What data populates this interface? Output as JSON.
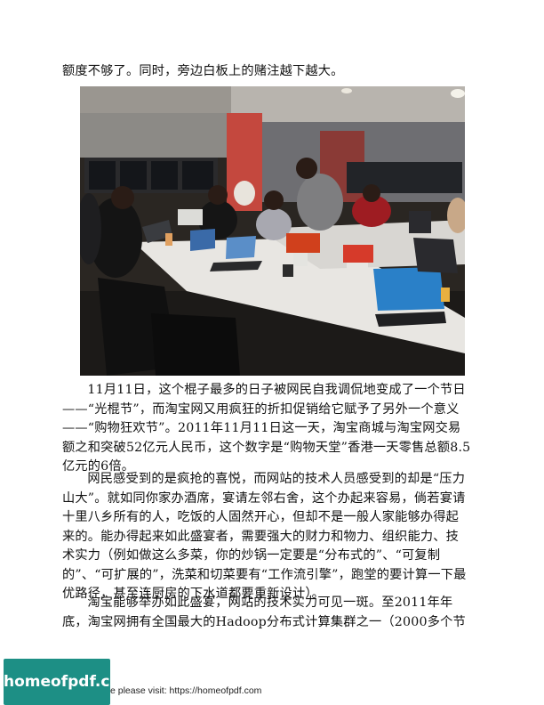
{
  "text": {
    "intro": "额度不够了。同时，旁边白板上的赌注越下越大。",
    "paragraph_1": "11月11日，这个棍子最多的日子被网民自我调侃地变成了一个节日——“光棍节”，而淘宝网又用疯狂的折扣促销给它赋予了另外一个意义——“购物狂欢节”。2011年11月11日这一天，淘宝商城与淘宝网交易额之和突破52亿元人民币，这个数字是“购物天堂”香港一天零售总额8.5亿元的6倍。",
    "paragraph_2": "网民感受到的是疯抢的喜悦，而网站的技术人员感受到的却是“压力山大”。就如同你家办酒席，宴请左邻右舍，这个办起来容易，倘若宴请十里八乡所有的人，吃饭的人固然开心，但却不是一般人家能够办得起来的。能办得起来如此盛宴者，需要强大的财力和物力、组织能力、技术实力（例如做这么多菜，你的炒锅一定要是“分布式的”、“可复制的”、“可扩展的”，洗菜和切菜要有“工作流引擎”，跑堂的要计算一下最优路径，甚至连厨房的下水道都要重新设计）。",
    "paragraph_3": "淘宝能够举办如此盛宴，网站的技术实力可见一斑。至2011年年底，淘宝网拥有全国最大的Hadoop分布式计算集群之一（2000多个节"
  },
  "footer": {
    "logo_text": "homeofpdf.com",
    "visit_text": "e please visit: https://homeofpdf.com"
  }
}
